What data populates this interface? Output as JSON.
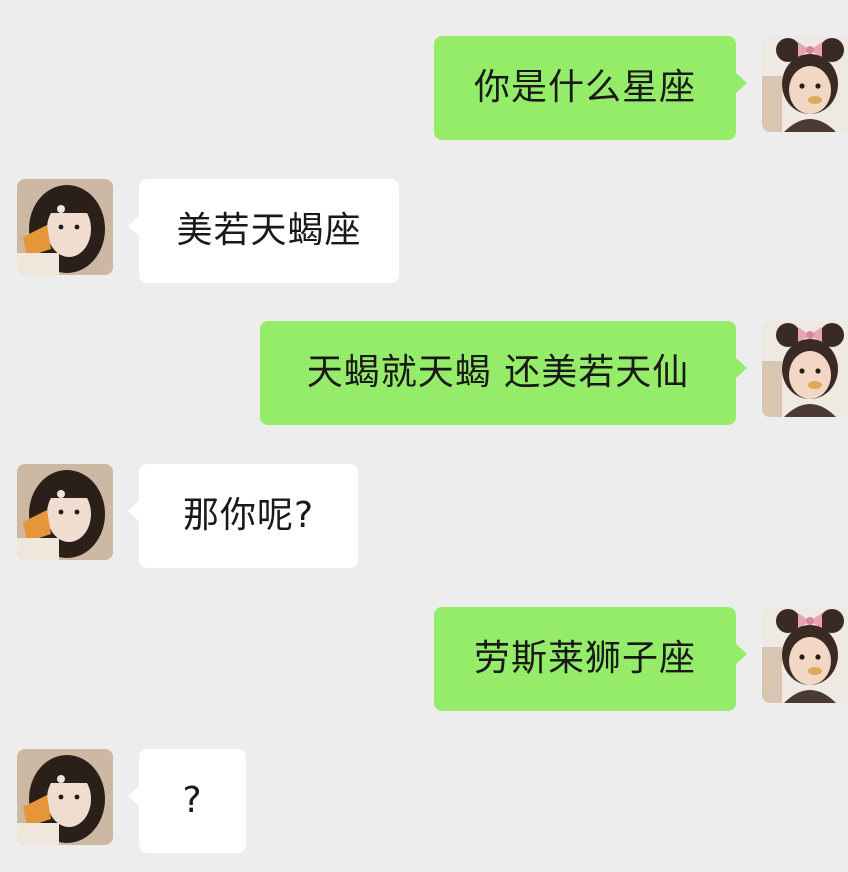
{
  "colors": {
    "background": "#ededed",
    "outgoing_bubble": "#95ec69",
    "incoming_bubble": "#ffffff",
    "text": "#191919"
  },
  "messages": [
    {
      "side": "out",
      "text": "你是什么星座"
    },
    {
      "side": "in",
      "text": "美若天蝎座"
    },
    {
      "side": "out",
      "text": "天蝎就天蝎 还美若天仙"
    },
    {
      "side": "in",
      "text": "那你呢?"
    },
    {
      "side": "out",
      "text": "劳斯莱狮子座"
    },
    {
      "side": "in",
      "text": "?"
    }
  ],
  "avatars": {
    "self": "avatar-girl-minnie-ears",
    "contact": "avatar-girl-long-hair"
  }
}
